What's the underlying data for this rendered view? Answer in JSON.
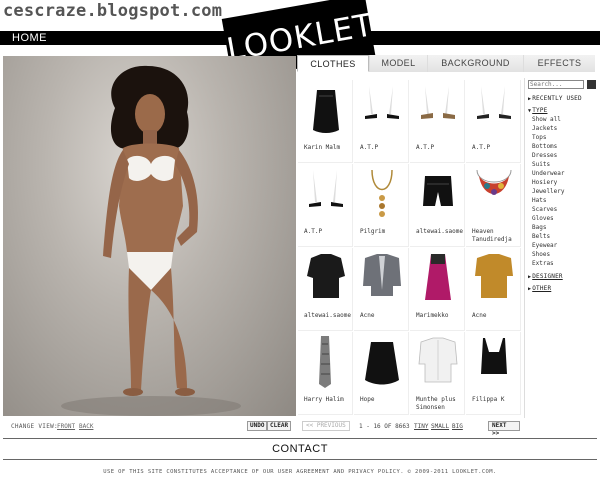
{
  "watermark": "cescraze.blogspot.com",
  "nav": {
    "home_label": "HOME"
  },
  "logo": {
    "text": "LOOKLET"
  },
  "tabs": [
    {
      "label": "CLOTHES",
      "active": true
    },
    {
      "label": "MODEL",
      "active": false
    },
    {
      "label": "BACKGROUND",
      "active": false
    },
    {
      "label": "EFFECTS",
      "active": false
    }
  ],
  "view_controls": {
    "change_view_label": "CHANGE VIEW:",
    "front_label": "FRONT",
    "back_label": "BACK",
    "undo_label": "UNDO",
    "clear_label": "CLEAR"
  },
  "items": [
    {
      "designer": "Karin Malm",
      "icon": "black-skirt"
    },
    {
      "designer": "A.T.P",
      "icon": "black-sandals"
    },
    {
      "designer": "A.T.P",
      "icon": "tan-sandals"
    },
    {
      "designer": "A.T.P",
      "icon": "black-sandals"
    },
    {
      "designer": "A.T.P",
      "icon": "black-sandals"
    },
    {
      "designer": "Pilgrim",
      "icon": "gold-necklace"
    },
    {
      "designer": "altewai.saome",
      "icon": "black-shorts"
    },
    {
      "designer": "Heaven Tanudiredja",
      "icon": "statement-necklace"
    },
    {
      "designer": "altewai.saome",
      "icon": "black-top"
    },
    {
      "designer": "Acne",
      "icon": "grey-jacket"
    },
    {
      "designer": "Marimekko",
      "icon": "magenta-dress"
    },
    {
      "designer": "Acne",
      "icon": "mustard-top"
    },
    {
      "designer": "Harry Halim",
      "icon": "scarf"
    },
    {
      "designer": "Hope",
      "icon": "black-skirt"
    },
    {
      "designer": "Munthe plus Simonsen",
      "icon": "white-blouse"
    },
    {
      "designer": "Filippa K",
      "icon": "black-tank"
    }
  ],
  "sidebar": {
    "search_placeholder": "Search...",
    "recently_used": "RECENTLY USED",
    "type_label": "TYPE",
    "types": [
      "Show all",
      "Jackets",
      "Tops",
      "Bottoms",
      "Dresses",
      "Suits",
      "Underwear",
      "Hosiery",
      "Jewellery",
      "Hats",
      "Scarves",
      "Gloves",
      "Bags",
      "Belts",
      "Eyewear",
      "Shoes",
      "Extras"
    ],
    "designer_label": "DESIGNER",
    "other_label": "OTHER"
  },
  "pager": {
    "prev_label": "<< PREVIOUS",
    "count_label": "1 - 16 OF 8663",
    "tiny_label": "TINY",
    "small_label": "SMALL",
    "big_label": "BIG",
    "next_label": "NEXT >>"
  },
  "contact": "CONTACT",
  "footer": "USE OF THIS SITE CONSTITUTES ACCEPTANCE OF OUR USER AGREEMENT AND PRIVACY POLICY. © 2009-2011 LOOKLET.COM."
}
